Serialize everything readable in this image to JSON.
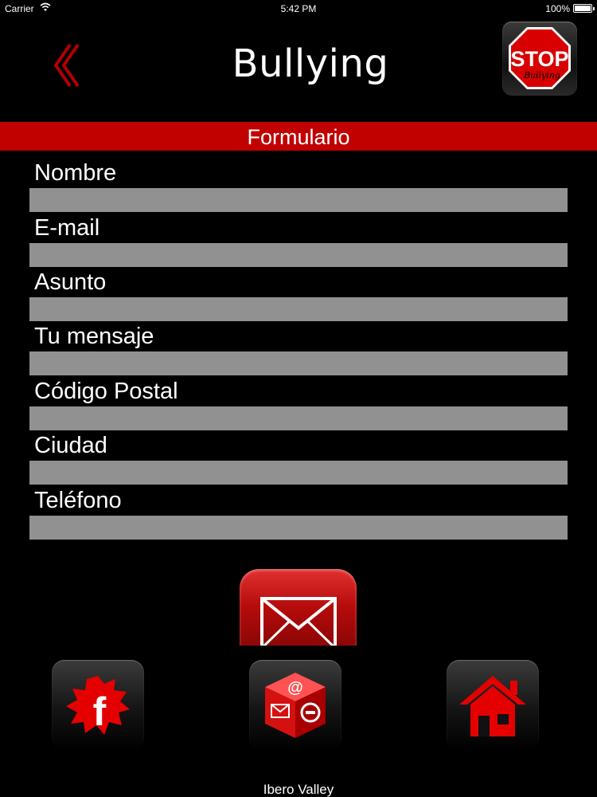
{
  "status_bar": {
    "carrier": "Carrier",
    "time": "5:42 PM",
    "battery": "100%"
  },
  "header": {
    "title": "Bullying",
    "stop_sign_text": "STOP",
    "stop_sign_subtext": "Bullying"
  },
  "section": {
    "title": "Formulario"
  },
  "form": {
    "fields": [
      {
        "label": "Nombre",
        "value": ""
      },
      {
        "label": "E-mail",
        "value": ""
      },
      {
        "label": "Asunto",
        "value": ""
      },
      {
        "label": "Tu mensaje",
        "value": ""
      },
      {
        "label": "Código Postal",
        "value": ""
      },
      {
        "label": "Ciudad",
        "value": ""
      },
      {
        "label": "Teléfono",
        "value": ""
      }
    ]
  },
  "bottom_nav": {
    "facebook_letter": "f"
  },
  "footer": {
    "text": "Ibero Valley"
  },
  "colors": {
    "accent": "#c10000",
    "background": "#000000",
    "input_fill": "#919191"
  }
}
